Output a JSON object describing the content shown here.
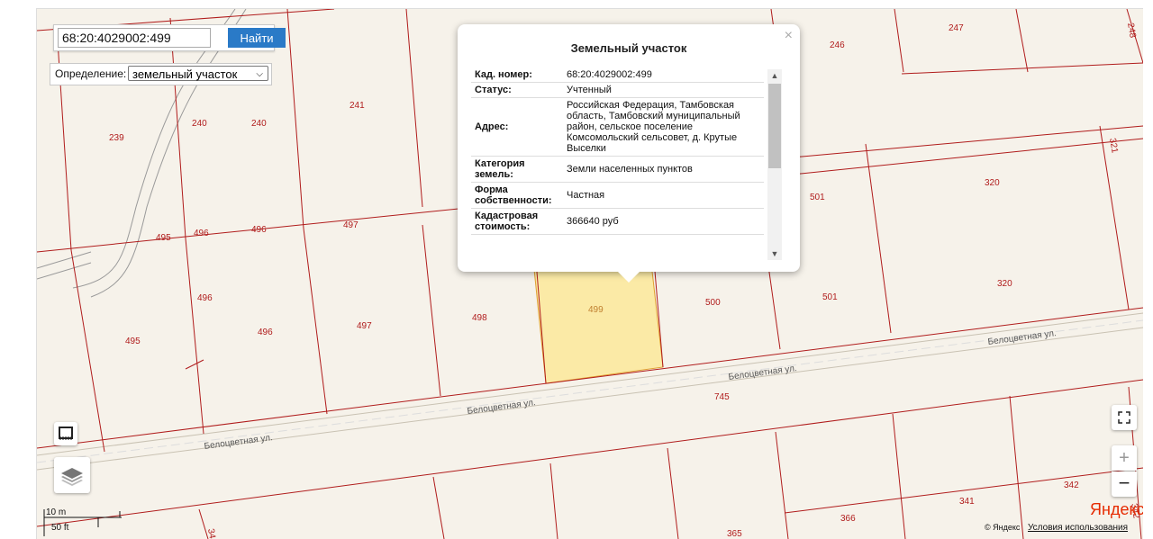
{
  "search": {
    "value": "68:20:4029002:499",
    "button": "Найти"
  },
  "definition": {
    "label": "Определение:",
    "selected": "земельный участок"
  },
  "popup": {
    "title": "Земельный участок",
    "close": "×",
    "rows": [
      {
        "key": "Кад. номер:",
        "value": "68:20:4029002:499"
      },
      {
        "key": "Статус:",
        "value": "Учтенный"
      },
      {
        "key": "Адрес:",
        "value": "Российская Федерация, Тамбовская область, Тамбовский муниципальный район, сельское поселение Комсомольский сельсовет, д. Крутые Выселки"
      },
      {
        "key": "Категория земель:",
        "value": "Земли населенных пунктов"
      },
      {
        "key": "Форма собственности:",
        "value": "Частная"
      },
      {
        "key": "Кадастровая стоимость:",
        "value": "366640 руб"
      }
    ]
  },
  "map": {
    "plots": [
      "239",
      "240",
      "240",
      "241",
      "246",
      "247",
      "248",
      "321",
      "320",
      "320",
      "501",
      "501",
      "495",
      "496",
      "496",
      "497",
      "495",
      "496",
      "496",
      "497",
      "498",
      "499",
      "500",
      "745",
      "341",
      "342",
      "342",
      "366",
      "365",
      "34"
    ],
    "street_name": "Белоцветная ул.",
    "selected_plot_color": "#fbeaa6"
  },
  "scale": {
    "metric": "10 m",
    "imperial": "50 ft"
  },
  "controls": {
    "zoom_in": "+",
    "zoom_out": "−"
  },
  "attribution": {
    "logo": "Яндекс",
    "copyright": "© Яндекс",
    "terms": "Условия использования"
  }
}
